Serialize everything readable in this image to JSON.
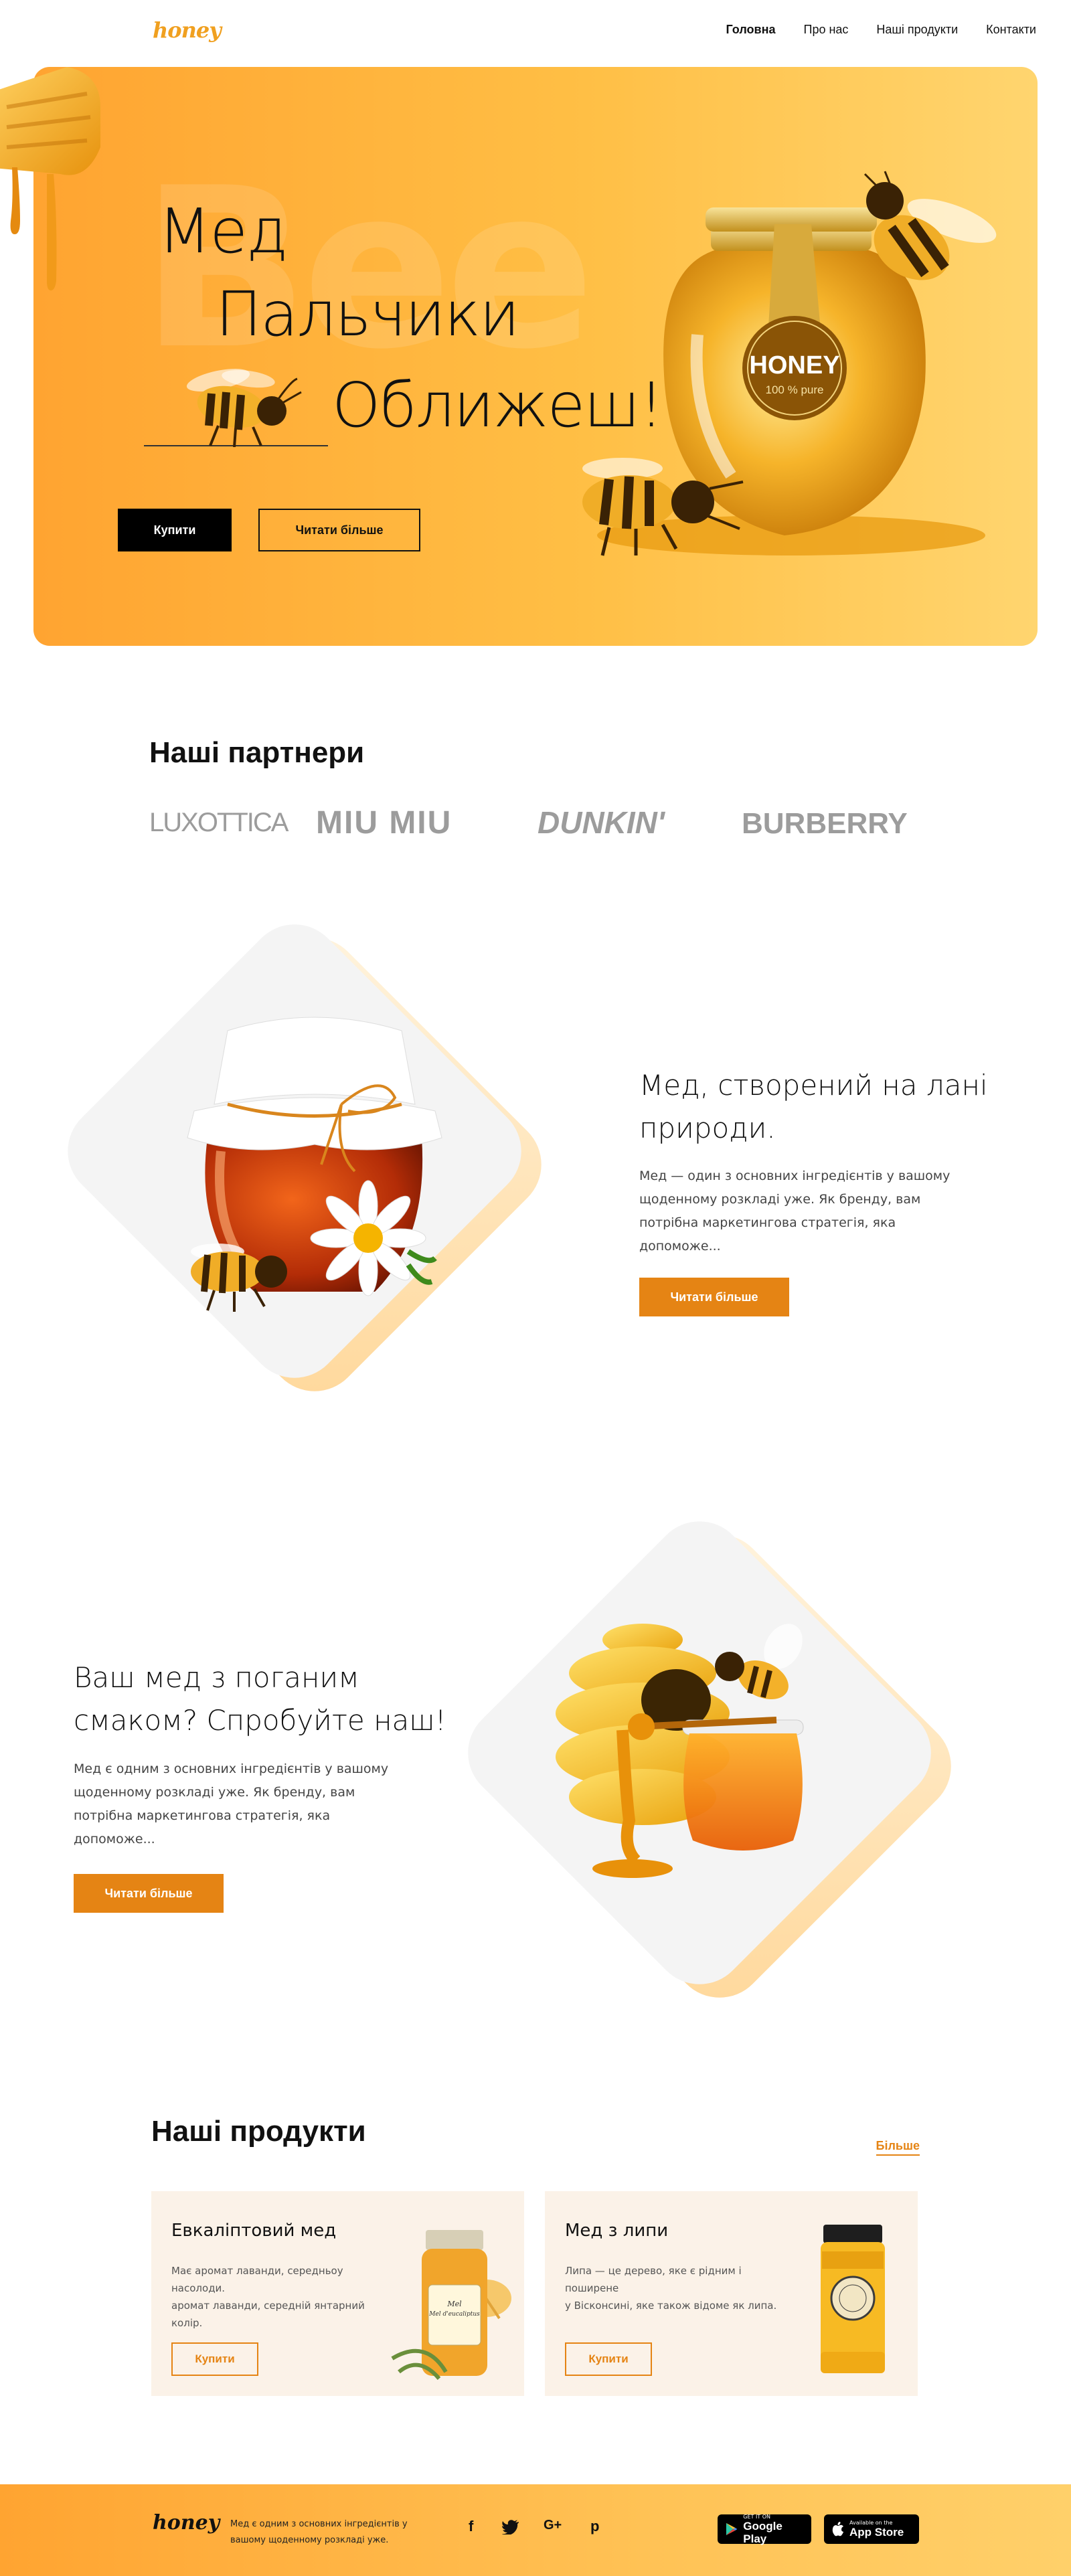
{
  "brand": {
    "logo": "honey"
  },
  "nav": {
    "items": [
      "Головна",
      "Про нас",
      "Наші продукти",
      "Контакти"
    ],
    "active": "Головна"
  },
  "hero": {
    "line1": "Мед",
    "line2": "Пальчики",
    "line3": "Оближеш!",
    "buy_label": "Купити",
    "read_more_label": "Читати більше",
    "jar_label": "HONEY",
    "jar_sublabel": "100 % pure",
    "bg_start": "#ffa431",
    "bg_end": "#ffd56f"
  },
  "partners": {
    "title": "Наші партнери",
    "logos": [
      "LUXOTTICA",
      "MIU MIU",
      "DUNKIN'",
      "BURBERRY"
    ]
  },
  "feature1": {
    "title_line1": "Мед, створений на лані",
    "title_line2": "природи.",
    "text_line1": "Мед — один з основних інгредієнтів у вашому",
    "text_line2": "щоденному розкладі уже. Як бренду, вам",
    "text_line3": "потрібна маркетингова стратегія, яка",
    "text_line4": "допоможе...",
    "button_label": "Читати більше"
  },
  "feature2": {
    "title_line1": "Ваш мед з поганим",
    "title_line2": "смаком? Спробуйте наш!",
    "text_line1": "Мед є одним з основних інгредієнтів у вашому",
    "text_line2": "щоденному розкладі уже. Як бренду, вам",
    "text_line3": "потрібна маркетингова стратегія, яка",
    "text_line4": "допоможе...",
    "button_label": "Читати більше"
  },
  "products": {
    "title": "Наші продукти",
    "more_label": "Більше",
    "items": [
      {
        "name": "Евкаліптовий мед",
        "desc_line1": "Має аромат лаванди, середньоу",
        "desc_line2": "насолоди.",
        "desc_line3": "аромат лаванди, середній янтарний",
        "desc_line4": "колір.",
        "buy_label": "Купити",
        "jar_label": "Mel d'eucaliptus"
      },
      {
        "name": "Мед з липи",
        "desc_line1": "Липа — це дерево, яке є рідним і поширене",
        "desc_line2": "у Вісконсині, яке також відоме як липа.",
        "desc_line3": "",
        "desc_line4": "",
        "buy_label": "Купити"
      }
    ]
  },
  "footer": {
    "logo": "honey",
    "text_line1": "Мед є одним з основних інгредієнтів у",
    "text_line2": "вашому щоденному розкладі уже.",
    "social": {
      "facebook": "f",
      "google": "G+",
      "pinterest": "p"
    },
    "google_play_small": "GET IT ON",
    "google_play_big": "Google Play",
    "app_store_small": "Available on the",
    "app_store_big": "App Store"
  },
  "colors": {
    "accent": "#e58414",
    "honey": "#ffb43b"
  }
}
